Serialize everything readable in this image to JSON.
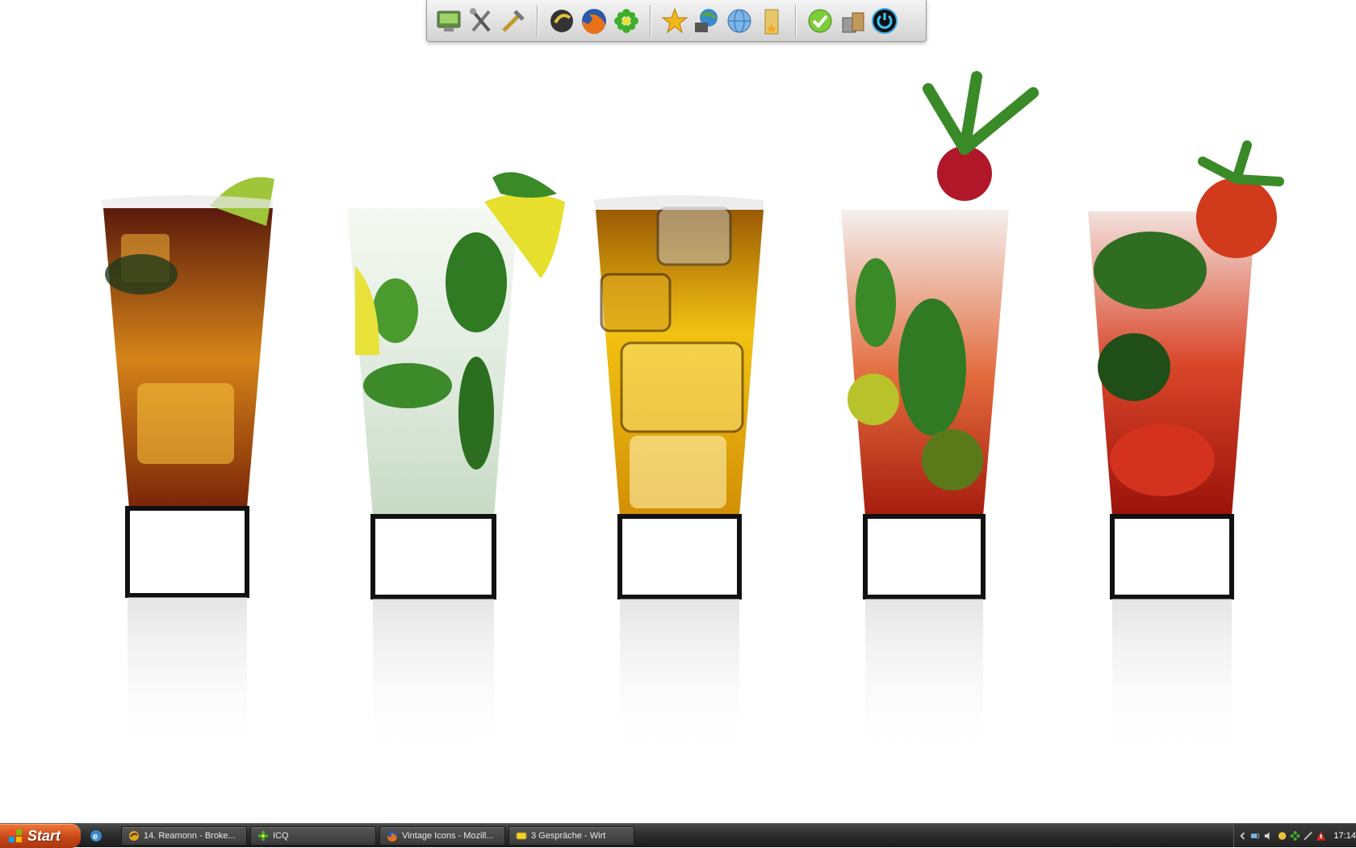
{
  "dock": {
    "icons": [
      "my-computer-icon",
      "tools-icon",
      "settings-icon",
      "media-player-icon",
      "firefox-icon",
      "icq-icon",
      "favorites-star-icon",
      "network-icon",
      "internet-globe-icon",
      "folder-icon",
      "checkmark-icon",
      "recycle-bin-icon",
      "power-icon"
    ]
  },
  "taskbar": {
    "start_label": "Start",
    "tasks": [
      {
        "label": "14. Reamonn - Broke...",
        "icon": "winamp-icon"
      },
      {
        "label": "ICQ",
        "icon": "icq-icon"
      },
      {
        "label": "Vintage Icons - Mozill...",
        "icon": "firefox-icon"
      },
      {
        "label": "3 Gespräche - Wirt",
        "icon": "chat-icon"
      }
    ],
    "clock": "17:14"
  },
  "colors": {
    "start_button": "#d65a25",
    "taskbar": "#2e2e2e",
    "dock_bg": "#e2e2e2"
  }
}
